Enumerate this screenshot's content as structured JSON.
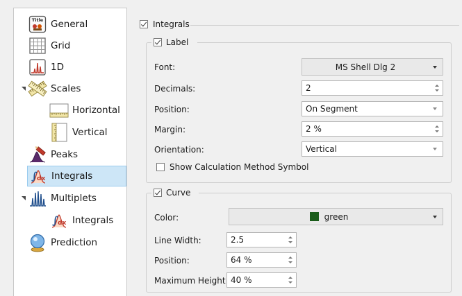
{
  "nav": {
    "items": [
      {
        "label": "General",
        "icon": "title-icon"
      },
      {
        "label": "Grid",
        "icon": "grid-icon"
      },
      {
        "label": "1D",
        "icon": "spectrum-1d-icon"
      },
      {
        "label": "Scales",
        "icon": "ruler-icon",
        "expanded": true
      },
      {
        "label": "Horizontal",
        "icon": "horizontal-ruler-icon"
      },
      {
        "label": "Vertical",
        "icon": "vertical-ruler-icon"
      },
      {
        "label": "Peaks",
        "icon": "peak-pick-icon"
      },
      {
        "label": "Integrals",
        "icon": "integral-icon",
        "selected": true
      },
      {
        "label": "Multiplets",
        "icon": "multiplet-icon",
        "expanded": true
      },
      {
        "label": "Integrals",
        "icon": "integral-icon"
      },
      {
        "label": "Prediction",
        "icon": "prediction-icon"
      }
    ]
  },
  "integrals": {
    "title": "Integrals",
    "checked": true
  },
  "label_group": {
    "title": "Label",
    "checked": true,
    "font_label": "Font:",
    "font_value": "MS Shell Dlg 2",
    "decimals_label": "Decimals:",
    "decimals_value": "2",
    "position_label": "Position:",
    "position_value": "On Segment",
    "margin_label": "Margin:",
    "margin_value": "2 %",
    "orientation_label": "Orientation:",
    "orientation_value": "Vertical",
    "show_calc_label": "Show Calculation Method Symbol",
    "show_calc_checked": false
  },
  "curve_group": {
    "title": "Curve",
    "checked": true,
    "color_label": "Color:",
    "color_value": "green",
    "color_hex": "#1a5c1a",
    "line_width_label": "Line Width:",
    "line_width_value": "2.5",
    "position_label": "Position:",
    "position_value": "64 %",
    "max_height_label": "Maximum Height:",
    "max_height_value": "40 %"
  },
  "colors": {
    "selection_bg": "#cde6f7",
    "selection_border": "#99cbee",
    "panel_bg": "#f0f0f0"
  }
}
